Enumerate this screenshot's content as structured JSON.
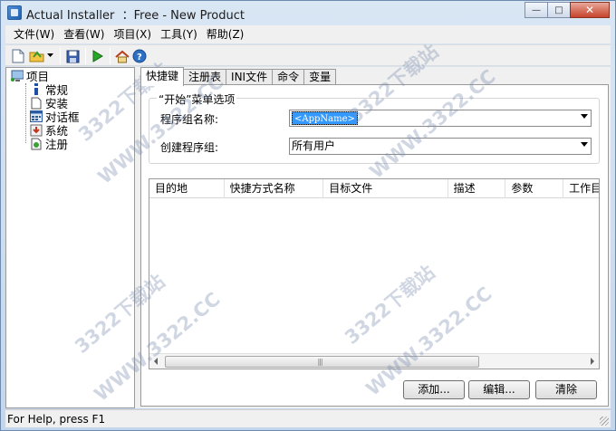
{
  "window": {
    "title": "Actual Installer  ：Free - New Product",
    "controls": {
      "minimize": "—",
      "maximize": "□",
      "close": "✕"
    }
  },
  "menu": [
    "文件(W)",
    "查看(W)",
    "项目(X)",
    "工具(Y)",
    "帮助(Z)"
  ],
  "toolbar": {
    "icons": [
      "new-file-icon",
      "open-folder-icon",
      "dropdown-arrow-icon",
      "save-icon",
      "run-build-icon",
      "home-icon",
      "help-icon"
    ]
  },
  "tree": {
    "root": "项目",
    "items": [
      "常规",
      "安装",
      "对话框",
      "系统",
      "注册"
    ]
  },
  "tabs": [
    "快捷键",
    "注册表",
    "INI文件",
    "命令",
    "变量"
  ],
  "active_tab": "快捷键",
  "start_menu": {
    "group_title": "“开始”菜单选项",
    "program_group_label": "程序组名称:",
    "program_group_value": "<AppName>",
    "create_group_label": "创建程序组:",
    "create_group_value": "所有用户"
  },
  "shortcut_table": {
    "columns": [
      "目的地",
      "快捷方式名称",
      "目标文件",
      "描述",
      "参数",
      "工作目"
    ],
    "rows": []
  },
  "buttons": {
    "add": "添加...",
    "edit": "编辑...",
    "clear": "清除"
  },
  "status": "For Help, press F1",
  "watermarks": [
    "3322下载站",
    "WWW.3322.CC"
  ]
}
